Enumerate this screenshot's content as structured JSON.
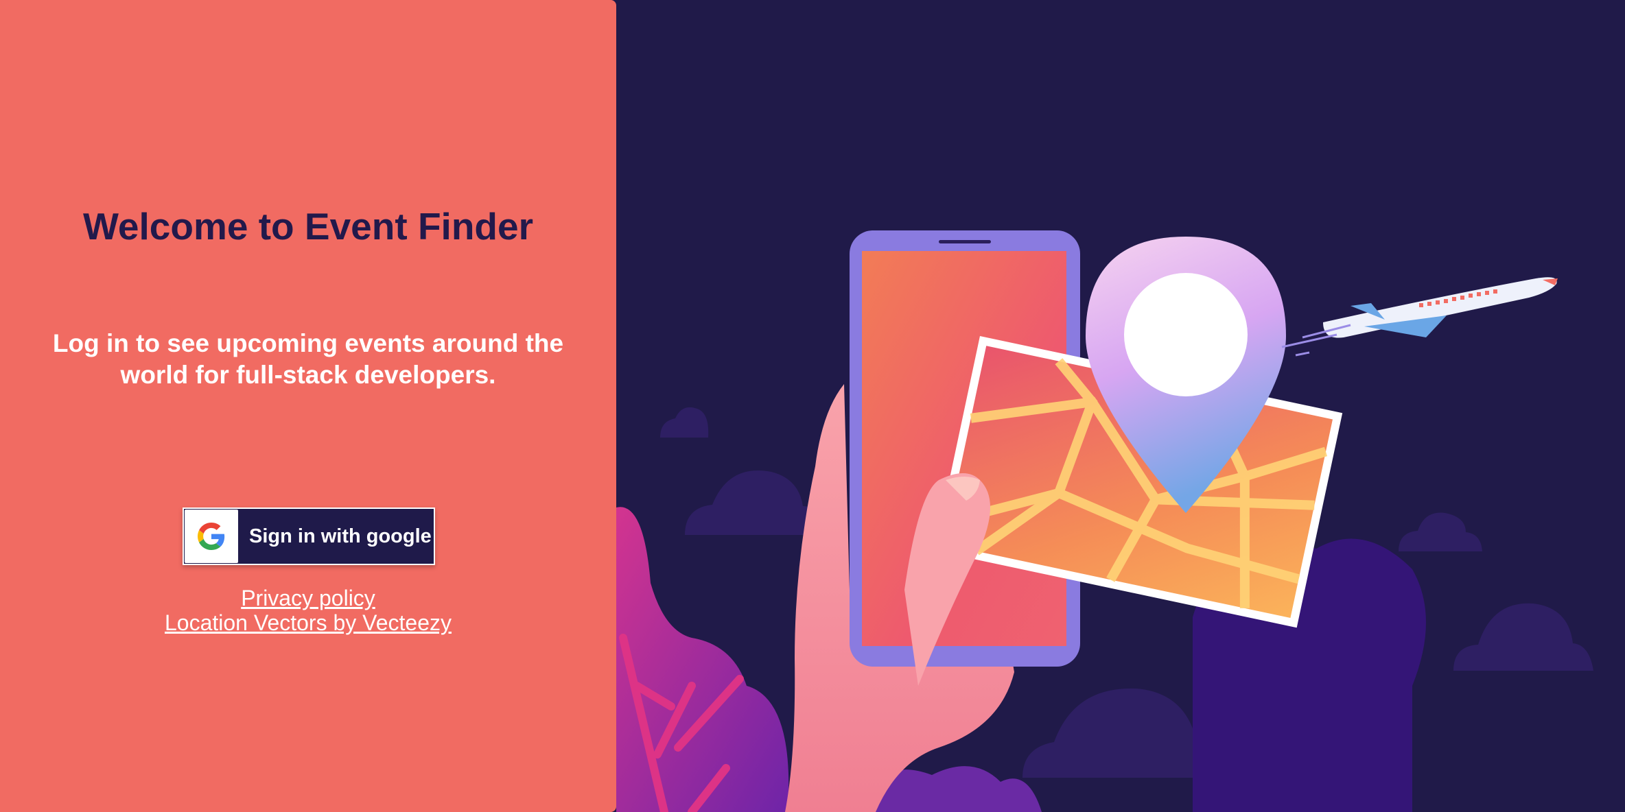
{
  "title": "Welcome to Event Finder",
  "subtitle": "Log in to see upcoming events around the world for full-stack developers.",
  "signin": {
    "label": "Sign in with google",
    "icon": "google-icon"
  },
  "links": {
    "privacy": "Privacy policy",
    "attribution": "Location Vectors by Vecteezy"
  },
  "colors": {
    "panel": "#f16b62",
    "background": "#201a49",
    "title": "#22194b",
    "button": "#1f1a4a"
  }
}
